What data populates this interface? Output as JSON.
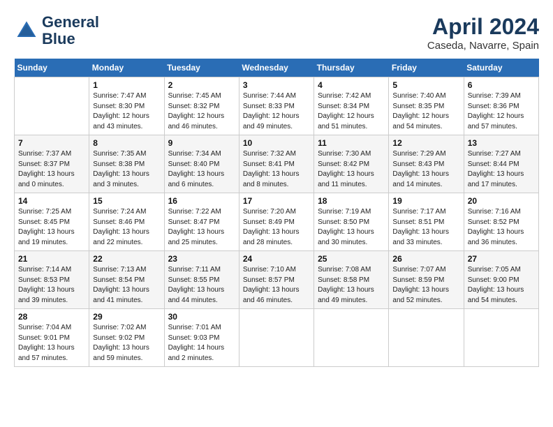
{
  "header": {
    "logo_line1": "General",
    "logo_line2": "Blue",
    "month_year": "April 2024",
    "location": "Caseda, Navarre, Spain"
  },
  "weekdays": [
    "Sunday",
    "Monday",
    "Tuesday",
    "Wednesday",
    "Thursday",
    "Friday",
    "Saturday"
  ],
  "weeks": [
    [
      {
        "day": "",
        "info": ""
      },
      {
        "day": "1",
        "info": "Sunrise: 7:47 AM\nSunset: 8:30 PM\nDaylight: 12 hours\nand 43 minutes."
      },
      {
        "day": "2",
        "info": "Sunrise: 7:45 AM\nSunset: 8:32 PM\nDaylight: 12 hours\nand 46 minutes."
      },
      {
        "day": "3",
        "info": "Sunrise: 7:44 AM\nSunset: 8:33 PM\nDaylight: 12 hours\nand 49 minutes."
      },
      {
        "day": "4",
        "info": "Sunrise: 7:42 AM\nSunset: 8:34 PM\nDaylight: 12 hours\nand 51 minutes."
      },
      {
        "day": "5",
        "info": "Sunrise: 7:40 AM\nSunset: 8:35 PM\nDaylight: 12 hours\nand 54 minutes."
      },
      {
        "day": "6",
        "info": "Sunrise: 7:39 AM\nSunset: 8:36 PM\nDaylight: 12 hours\nand 57 minutes."
      }
    ],
    [
      {
        "day": "7",
        "info": "Sunrise: 7:37 AM\nSunset: 8:37 PM\nDaylight: 13 hours\nand 0 minutes."
      },
      {
        "day": "8",
        "info": "Sunrise: 7:35 AM\nSunset: 8:38 PM\nDaylight: 13 hours\nand 3 minutes."
      },
      {
        "day": "9",
        "info": "Sunrise: 7:34 AM\nSunset: 8:40 PM\nDaylight: 13 hours\nand 6 minutes."
      },
      {
        "day": "10",
        "info": "Sunrise: 7:32 AM\nSunset: 8:41 PM\nDaylight: 13 hours\nand 8 minutes."
      },
      {
        "day": "11",
        "info": "Sunrise: 7:30 AM\nSunset: 8:42 PM\nDaylight: 13 hours\nand 11 minutes."
      },
      {
        "day": "12",
        "info": "Sunrise: 7:29 AM\nSunset: 8:43 PM\nDaylight: 13 hours\nand 14 minutes."
      },
      {
        "day": "13",
        "info": "Sunrise: 7:27 AM\nSunset: 8:44 PM\nDaylight: 13 hours\nand 17 minutes."
      }
    ],
    [
      {
        "day": "14",
        "info": "Sunrise: 7:25 AM\nSunset: 8:45 PM\nDaylight: 13 hours\nand 19 minutes."
      },
      {
        "day": "15",
        "info": "Sunrise: 7:24 AM\nSunset: 8:46 PM\nDaylight: 13 hours\nand 22 minutes."
      },
      {
        "day": "16",
        "info": "Sunrise: 7:22 AM\nSunset: 8:47 PM\nDaylight: 13 hours\nand 25 minutes."
      },
      {
        "day": "17",
        "info": "Sunrise: 7:20 AM\nSunset: 8:49 PM\nDaylight: 13 hours\nand 28 minutes."
      },
      {
        "day": "18",
        "info": "Sunrise: 7:19 AM\nSunset: 8:50 PM\nDaylight: 13 hours\nand 30 minutes."
      },
      {
        "day": "19",
        "info": "Sunrise: 7:17 AM\nSunset: 8:51 PM\nDaylight: 13 hours\nand 33 minutes."
      },
      {
        "day": "20",
        "info": "Sunrise: 7:16 AM\nSunset: 8:52 PM\nDaylight: 13 hours\nand 36 minutes."
      }
    ],
    [
      {
        "day": "21",
        "info": "Sunrise: 7:14 AM\nSunset: 8:53 PM\nDaylight: 13 hours\nand 39 minutes."
      },
      {
        "day": "22",
        "info": "Sunrise: 7:13 AM\nSunset: 8:54 PM\nDaylight: 13 hours\nand 41 minutes."
      },
      {
        "day": "23",
        "info": "Sunrise: 7:11 AM\nSunset: 8:55 PM\nDaylight: 13 hours\nand 44 minutes."
      },
      {
        "day": "24",
        "info": "Sunrise: 7:10 AM\nSunset: 8:57 PM\nDaylight: 13 hours\nand 46 minutes."
      },
      {
        "day": "25",
        "info": "Sunrise: 7:08 AM\nSunset: 8:58 PM\nDaylight: 13 hours\nand 49 minutes."
      },
      {
        "day": "26",
        "info": "Sunrise: 7:07 AM\nSunset: 8:59 PM\nDaylight: 13 hours\nand 52 minutes."
      },
      {
        "day": "27",
        "info": "Sunrise: 7:05 AM\nSunset: 9:00 PM\nDaylight: 13 hours\nand 54 minutes."
      }
    ],
    [
      {
        "day": "28",
        "info": "Sunrise: 7:04 AM\nSunset: 9:01 PM\nDaylight: 13 hours\nand 57 minutes."
      },
      {
        "day": "29",
        "info": "Sunrise: 7:02 AM\nSunset: 9:02 PM\nDaylight: 13 hours\nand 59 minutes."
      },
      {
        "day": "30",
        "info": "Sunrise: 7:01 AM\nSunset: 9:03 PM\nDaylight: 14 hours\nand 2 minutes."
      },
      {
        "day": "",
        "info": ""
      },
      {
        "day": "",
        "info": ""
      },
      {
        "day": "",
        "info": ""
      },
      {
        "day": "",
        "info": ""
      }
    ]
  ]
}
